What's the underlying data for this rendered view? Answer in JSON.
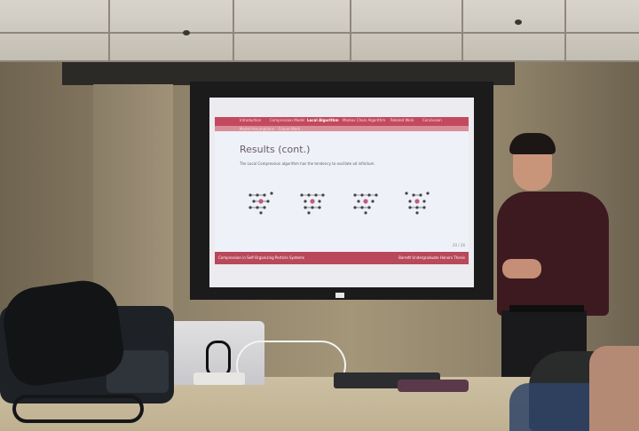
{
  "slide": {
    "nav_items": [
      "Introduction",
      "Compression Model",
      "Local Algorithm",
      "Markov Chain Algorithm",
      "Related Work",
      "Conclusion",
      "Model Assumptions",
      "Future Work"
    ],
    "active_nav_index": 2,
    "title": "Results (cont.)",
    "body": "The Local Compression algorithm has the tendency to oscillate ad infinitum.",
    "footer_left": "Compression in Self-Organizing Particle Systems",
    "footer_right": "Barrett Undergraduate Honors Thesis",
    "page_number": "20 / 26",
    "accent_color": "#c34a5e",
    "figure_count": 4
  }
}
